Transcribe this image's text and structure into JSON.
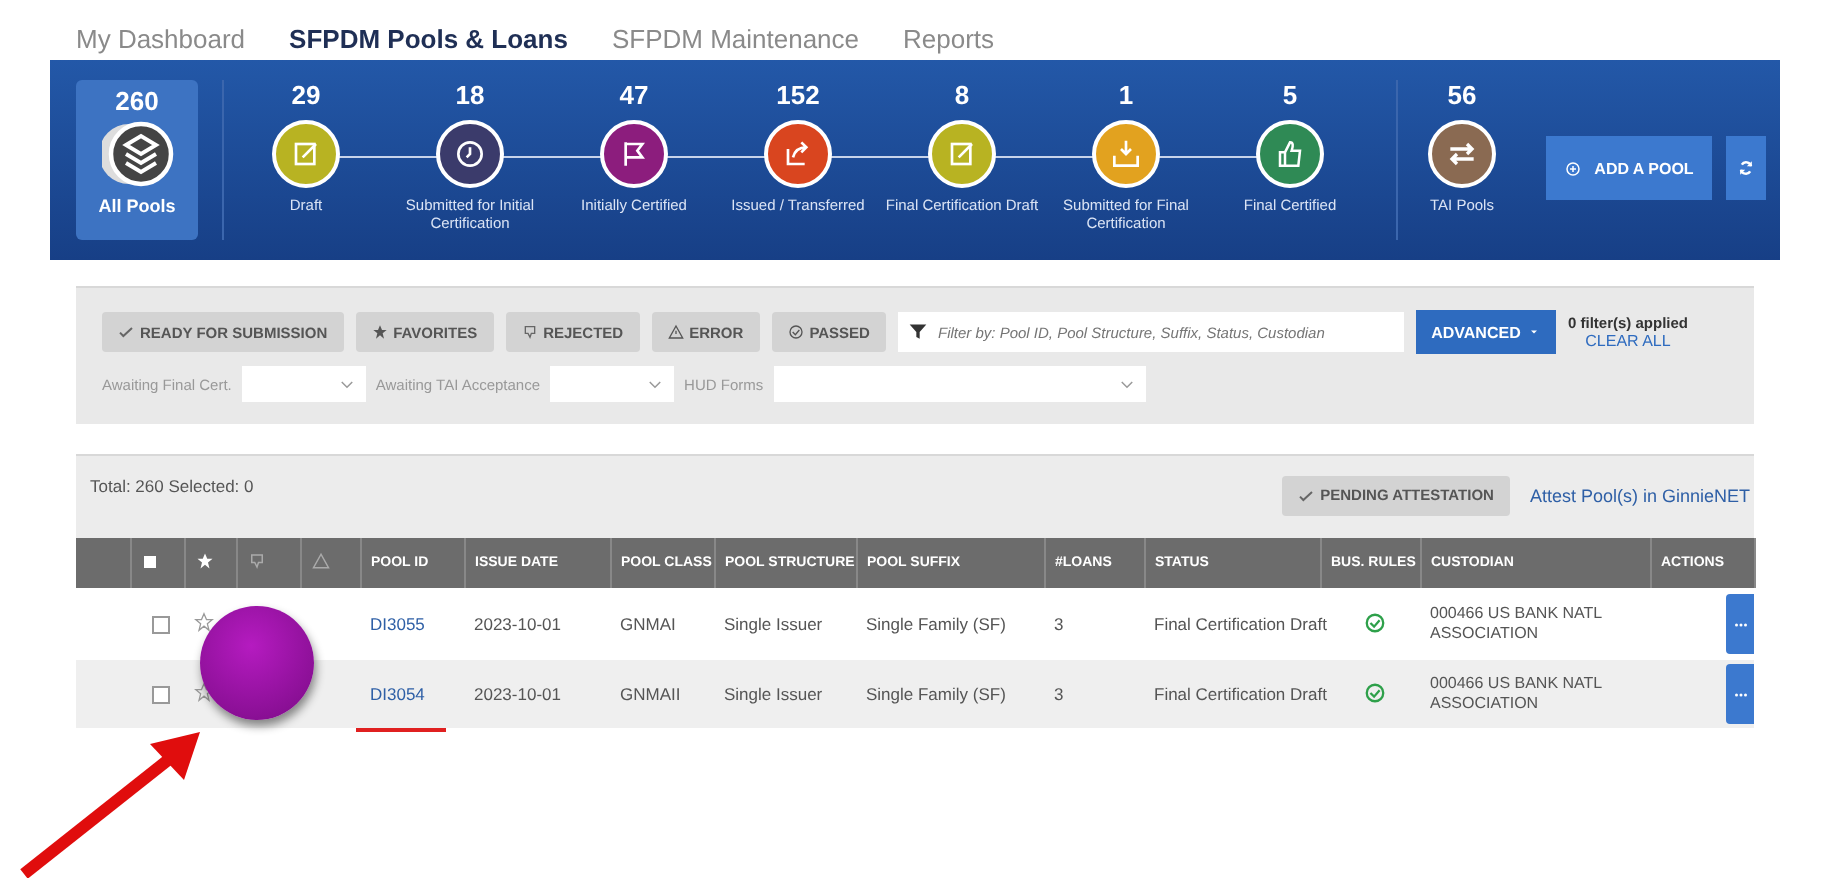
{
  "nav_tabs": [
    {
      "label": "My Dashboard",
      "selected": false
    },
    {
      "label": "SFPDM Pools & Loans",
      "selected": true
    },
    {
      "label": "SFPDM Maintenance",
      "selected": false
    },
    {
      "label": "Reports",
      "selected": false
    }
  ],
  "summary": {
    "all_pools": {
      "count": "260",
      "label": "All Pools",
      "selected": true
    },
    "stages": [
      {
        "count": "29",
        "label": "Draft",
        "color": "#b8b322"
      },
      {
        "count": "18",
        "label": "Submitted for Initial Certification",
        "color": "#3b3b6b"
      },
      {
        "count": "47",
        "label": "Initially Certified",
        "color": "#8c1d7d"
      },
      {
        "count": "152",
        "label": "Issued / Transferred",
        "color": "#d9451f"
      },
      {
        "count": "8",
        "label": "Final Certification Draft",
        "color": "#b8b322"
      },
      {
        "count": "1",
        "label": "Submitted for Final Certification",
        "color": "#e2a21f"
      },
      {
        "count": "5",
        "label": "Final Certified",
        "color": "#2f8a55"
      }
    ],
    "tai": {
      "count": "56",
      "label": "TAI Pools",
      "color": "#8a6a52"
    },
    "add_button": "ADD A POOL"
  },
  "filters": {
    "quick": [
      {
        "label": "READY FOR SUBMISSION",
        "selected": false
      },
      {
        "label": "FAVORITES",
        "selected": false
      },
      {
        "label": "REJECTED",
        "selected": false
      },
      {
        "label": "ERROR",
        "selected": false
      },
      {
        "label": "PASSED",
        "selected": false
      }
    ],
    "search": {
      "placeholder": "Filter by: Pool ID, Pool Structure, Suffix, Status, Custodian"
    },
    "advanced_button": "ADVANCED",
    "applied": "0 filter(s) applied",
    "clear": "CLEAR ALL",
    "selects": [
      {
        "label": "Awaiting Final Cert."
      },
      {
        "label": "Awaiting TAI Acceptance"
      },
      {
        "label": "HUD Forms"
      }
    ]
  },
  "table": {
    "total": "Total: 260 Selected: 0",
    "pending_button": "PENDING ATTESTATION",
    "attest_link": "Attest Pool(s) in GinnieNET",
    "columns": [
      "POOL ID",
      "ISSUE DATE",
      "POOL CLASS",
      "POOL STRUCTURE",
      "POOL SUFFIX",
      "#LOANS",
      "STATUS",
      "BUS. RULES",
      "CUSTODIAN",
      "ACTIONS"
    ],
    "rows": [
      {
        "checked": false,
        "favorite": false,
        "pool_id": "DI3055",
        "issue_date": "2023-10-01",
        "pool_class": "GNMAI",
        "structure": "Single Issuer",
        "suffix": "Single Family (SF)",
        "loans": "3",
        "status": "Final Certification Draft",
        "rules_passed": true,
        "custodian": "000466 US BANK NATL ASSOCIATION"
      },
      {
        "checked": false,
        "favorite": false,
        "pool_id": "DI3054",
        "issue_date": "2023-10-01",
        "pool_class": "GNMAII",
        "structure": "Single Issuer",
        "suffix": "Single Family (SF)",
        "loans": "3",
        "status": "Final Certification Draft",
        "rules_passed": true,
        "custodian": "000466 US BANK NATL ASSOCIATION"
      }
    ]
  }
}
